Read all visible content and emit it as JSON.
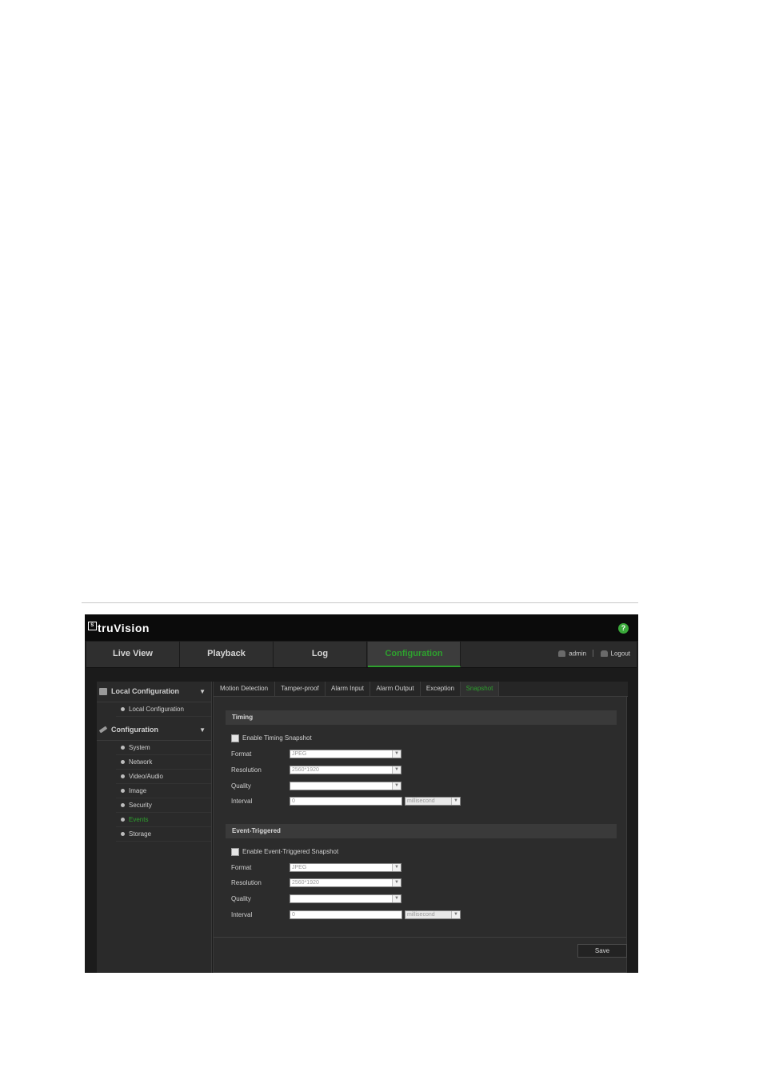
{
  "app": {
    "logo": "truVision",
    "logo_mark": "S",
    "help_icon": "?"
  },
  "nav": {
    "tabs": [
      {
        "label": "Live View"
      },
      {
        "label": "Playback"
      },
      {
        "label": "Log"
      },
      {
        "label": "Configuration"
      }
    ],
    "user": "admin",
    "logout": "Logout"
  },
  "sidebar": {
    "local_header": "Local Configuration",
    "local_items": [
      "Local Configuration"
    ],
    "config_header": "Configuration",
    "config_items": [
      "System",
      "Network",
      "Video/Audio",
      "Image",
      "Security",
      "Events",
      "Storage"
    ],
    "active_item": "Events"
  },
  "subtabs": [
    "Motion Detection",
    "Tamper-proof",
    "Alarm Input",
    "Alarm Output",
    "Exception",
    "Snapshot"
  ],
  "timing": {
    "title": "Timing",
    "enable_label": "Enable Timing Snapshot",
    "format_label": "Format",
    "format_value": "JPEG",
    "resolution_label": "Resolution",
    "resolution_value": "2560*1920",
    "quality_label": "Quality",
    "quality_value": "",
    "interval_label": "Interval",
    "interval_value": "0",
    "interval_unit": "millisecond"
  },
  "event": {
    "title": "Event-Triggered",
    "enable_label": "Enable Event-Triggered Snapshot",
    "format_label": "Format",
    "format_value": "JPEG",
    "resolution_label": "Resolution",
    "resolution_value": "2560*1920",
    "quality_label": "Quality",
    "quality_value": "",
    "interval_label": "Interval",
    "interval_value": "0",
    "interval_unit": "millisecond"
  },
  "save_label": "Save",
  "colors": {
    "accent": "#2ea02e",
    "background": "#1b1b1b"
  }
}
